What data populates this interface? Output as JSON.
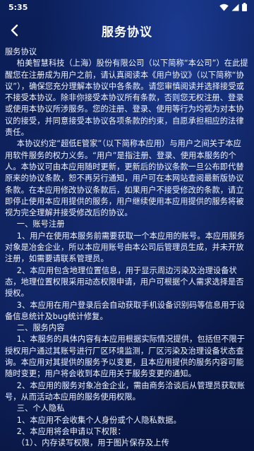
{
  "status_bar": {
    "time": "5:35"
  },
  "header": {
    "title": "服务协议"
  },
  "body": {
    "paragraphs": [
      {
        "text": "服务协议",
        "indent": false
      },
      {
        "text": "柏美智慧科技（上海）股份有限公司（以下简称“本公司”）在此提醒您在注册成为用户之前，请认真阅读本《用户协议》（以下简称“协议”），确保您充分理解本协议中各条款。请您审慎阅读并选择接受或不接受本协议。除非你接受本协议所有条款，否则您无权注册、登录或使用本协议所涉服务。您的注册、登录、使用等行为均视为对本协议的接受，并同意接受本协议各项条款的约束，自愿承担相应的法律责任。",
        "indent": true
      },
      {
        "text": "本协议约定“超低E管家”（以下简称本应用）与用户之间关于本应用软件服务的权力义务。“用户”是指注册、登录、使用本服务的个人。本协议可由本应用随时更新，更新后的协议条款一旦公布即代替原来的协议条款，恕不再另行通知，用户可在本网站查阅最新版协议条款。在本应用修改协议条款后，如果用户不接受修改的条款，请立即停止使用本应用提供的服务，用户继续使用本应用提供的服务将被视为完全理解并接受修改后的协议。",
        "indent": true
      },
      {
        "text": "一、账号注册",
        "indent": true
      },
      {
        "text": "1、用户在使用本服务前需要获取一个本应用的账号。本应用服务对象是冶金企业，所以本应用账号由本公司后管理员生成，并未开放注册，如需要请联系管理员。",
        "indent": true
      },
      {
        "text": "2、本应用包含地理位置信息，用于显示周边污染及治理设备状态，地理位置权限采用动态权限申请，用户可根据个人需求选择是否授权。",
        "indent": true
      },
      {
        "text": "3、本应用在用户登录后会自动获取手机设备识别码等信息用于设备信息统计及bug统计修复。",
        "indent": true
      },
      {
        "text": "二、服务内容",
        "indent": true
      },
      {
        "text": "1、本服务的具体内容有本应用根据实际情况提供，包括但不限于授权用户通过其账号进行厂区环境监测，厂区污染及治理设备状态查询。本应用对其提供的服务予以变更，且本应用提供的服务内容可能随时变更；用户将会收到本应用关于服务变更的通知。",
        "indent": true
      },
      {
        "text": "2、本应用的服务对象冶金企业，需由商务洽谈后从管理员获取账号，从而活动本应用的服务使用权限。",
        "indent": true
      },
      {
        "text": "三、个人隐私",
        "indent": true
      },
      {
        "text": "1、本应用不会收集个人身份或个人隐私数据。",
        "indent": true
      },
      {
        "text": "2、本应用将会申请以下权限：",
        "indent": true
      },
      {
        "text": "（1）、内存读写权限，用于图片保存及上传",
        "indent": true
      }
    ]
  }
}
